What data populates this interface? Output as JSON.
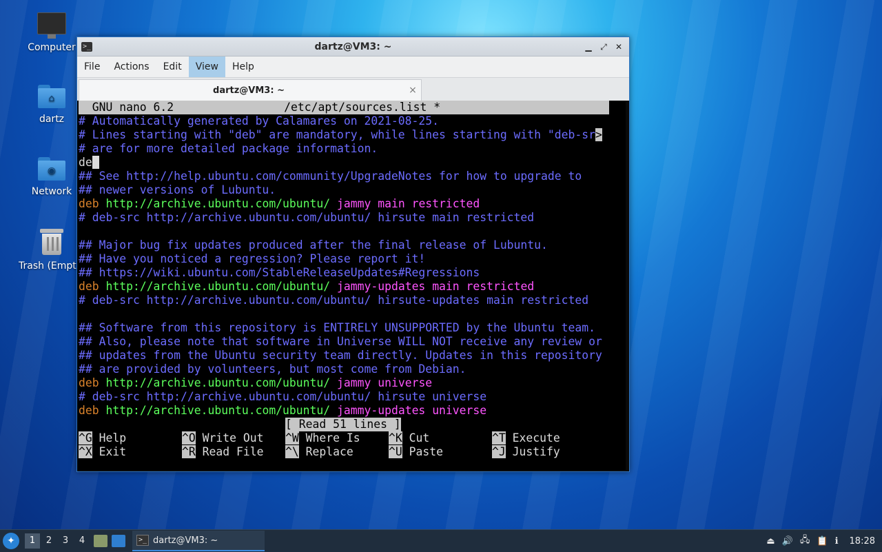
{
  "desktop": {
    "icons": [
      {
        "label": "Computer"
      },
      {
        "label": "dartz"
      },
      {
        "label": "Network"
      },
      {
        "label": "Trash (Empty)"
      }
    ]
  },
  "window": {
    "title": "dartz@VM3: ~",
    "menu": [
      "File",
      "Actions",
      "Edit",
      "View",
      "Help"
    ],
    "active_menu": "View",
    "tab_label": "dartz@VM3: ~",
    "close_glyph": "×"
  },
  "nano": {
    "header_left": "  GNU nano 6.2",
    "header_file": "/etc/apt/sources.list *",
    "lines": [
      "# Automatically generated by Calamares on 2021-08-25.",
      "# Lines starting with \"deb\" are mandatory, while lines starting with \"deb-sr",
      "# are for more detailed package information.",
      "de",
      "## See http://help.ubuntu.com/community/UpgradeNotes for how to upgrade to",
      "## newer versions of Lubuntu.",
      "deb",
      "# deb-src http://archive.ubuntu.com/ubuntu/ hirsute main restricted",
      "",
      "## Major bug fix updates produced after the final release of Lubuntu.",
      "## Have you noticed a regression? Please report it!",
      "## https://wiki.ubuntu.com/StableReleaseUpdates#Regressions",
      "deb",
      "# deb-src http://archive.ubuntu.com/ubuntu/ hirsute-updates main restricted",
      "",
      "## Software from this repository is ENTIRELY UNSUPPORTED by the Ubuntu team.",
      "## Also, please note that software in Universe WILL NOT receive any review or",
      "## updates from the Ubuntu security team directly. Updates in this repository",
      "## are provided by volunteers, but most come from Debian.",
      "deb",
      "# deb-src http://archive.ubuntu.com/ubuntu/ hirsute universe",
      "deb"
    ],
    "overflow_marker": ">",
    "deb_url": "http://archive.ubuntu.com/ubuntu/",
    "suite1": "jammy",
    "comp1": "main restricted",
    "suite2": "jammy-updates",
    "comp2": "main restricted",
    "suite3": "jammy",
    "comp3": "universe",
    "suite4": "jammy-updates",
    "comp4": "universe",
    "status": "[ Read 51 lines ]",
    "shortcuts": [
      {
        "key": "^G",
        "label": "Help"
      },
      {
        "key": "^O",
        "label": "Write Out"
      },
      {
        "key": "^W",
        "label": "Where Is"
      },
      {
        "key": "^K",
        "label": "Cut"
      },
      {
        "key": "^T",
        "label": "Execute"
      },
      {
        "key": "^X",
        "label": "Exit"
      },
      {
        "key": "^R",
        "label": "Read File"
      },
      {
        "key": "^\\",
        "label": "Replace"
      },
      {
        "key": "^U",
        "label": "Paste"
      },
      {
        "key": "^J",
        "label": "Justify"
      }
    ]
  },
  "taskbar": {
    "workspaces": [
      "1",
      "2",
      "3",
      "4"
    ],
    "active_workspace": "1",
    "task_label": "dartz@VM3: ~",
    "clock": "18:28"
  },
  "colors": {
    "comment": "#6c6cff",
    "deb_keyword": "#d9822b",
    "url": "#5cff5c",
    "suite": "#ff55ff"
  }
}
